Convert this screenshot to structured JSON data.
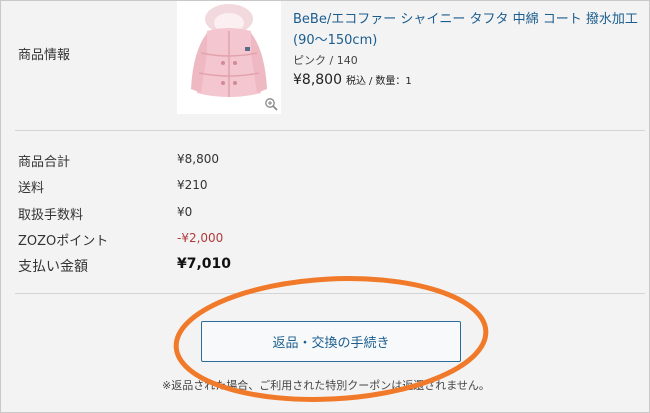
{
  "product": {
    "section_label": "商品情報",
    "title": "BeBe/エコファー シャイニー タフタ 中綿 コート 撥水加工(90〜150cm)",
    "variant": "ピンク / 140",
    "price": "¥8,800",
    "tax_label": "税込",
    "separator": "/",
    "quantity": "数量：1",
    "zoom_icon": "zoom-in-icon"
  },
  "summary": {
    "rows": [
      {
        "label": "商品合計",
        "value": "¥8,800"
      },
      {
        "label": "送料",
        "value": "¥210"
      },
      {
        "label": "取扱手数料",
        "value": "¥0"
      },
      {
        "label": "ZOZOポイント",
        "value": "-¥2,000"
      }
    ],
    "total_label": "支払い金額",
    "total_value": "¥7,010",
    "point_color": "#b23a3a"
  },
  "actions": {
    "return_button_label": "返品・交換の手続き",
    "note": "※返品された場合、ご利用された特別クーポンは返還されません。"
  },
  "annotation": {
    "color": "#f07a2a"
  }
}
